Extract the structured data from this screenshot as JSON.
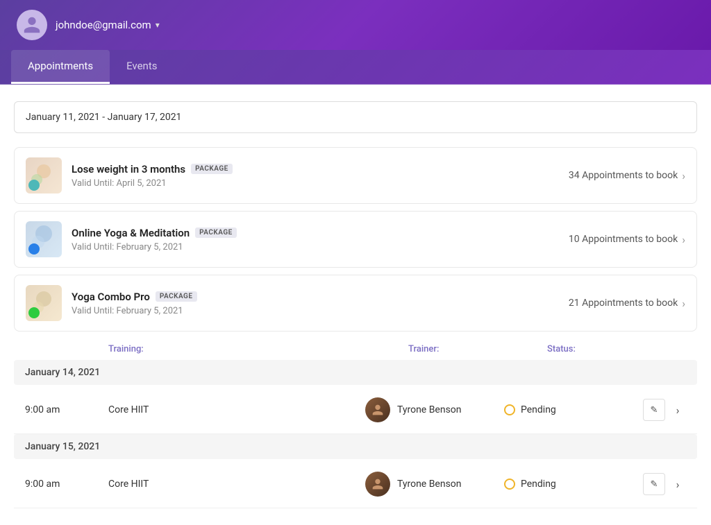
{
  "header": {
    "user_email": "johndoe@gmail.com",
    "avatar_alt": "User avatar"
  },
  "tabs": [
    {
      "id": "appointments",
      "label": "Appointments",
      "active": true
    },
    {
      "id": "events",
      "label": "Events",
      "active": false
    }
  ],
  "date_range": {
    "value": "January 11, 2021 - January 17, 2021",
    "placeholder": "Select date range"
  },
  "packages": [
    {
      "id": "pkg1",
      "name": "Lose weight in 3 months",
      "badge": "PACKAGE",
      "valid_label": "Valid Until:",
      "valid_date": "April 5, 2021",
      "appointments_count": "34 Appointments to book",
      "thumb_type": "1"
    },
    {
      "id": "pkg2",
      "name": "Online Yoga & Meditation",
      "badge": "PACKAGE",
      "valid_label": "Valid Until:",
      "valid_date": "February 5, 2021",
      "appointments_count": "10 Appointments to book",
      "thumb_type": "2"
    },
    {
      "id": "pkg3",
      "name": "Yoga Combo Pro",
      "badge": "PACKAGE",
      "valid_label": "Valid Until:",
      "valid_date": "February 5, 2021",
      "appointments_count": "21 Appointments to book",
      "thumb_type": "3"
    }
  ],
  "schedule_headers": {
    "training": "Training:",
    "trainer": "Trainer:",
    "status": "Status:"
  },
  "schedule_groups": [
    {
      "date": "January 14, 2021",
      "appointments": [
        {
          "time": "9:00 am",
          "training": "Core HIIT",
          "trainer": "Tyrone Benson",
          "status": "Pending"
        }
      ]
    },
    {
      "date": "January 15, 2021",
      "appointments": [
        {
          "time": "9:00 am",
          "training": "Core HIIT",
          "trainer": "Tyrone Benson",
          "status": "Pending"
        }
      ]
    }
  ],
  "icons": {
    "chevron_down": "▾",
    "chevron_right": "›",
    "edit": "✎"
  }
}
